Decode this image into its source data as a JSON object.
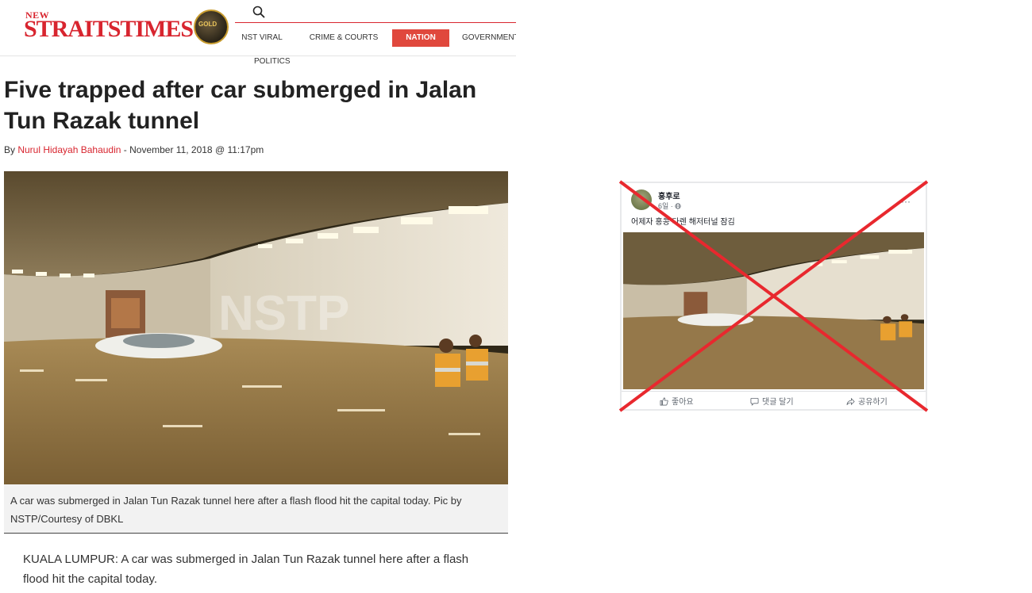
{
  "header": {
    "logo_new": "NEW",
    "logo_main": "STRAITSTIMES",
    "logo_badge": "GOLD",
    "nav": [
      {
        "label": "NST VIRAL",
        "active": false
      },
      {
        "label": "CRIME & COURTS",
        "active": false
      },
      {
        "label": "NATION",
        "active": true
      },
      {
        "label": "GOVERNMENT",
        "active": false
      }
    ],
    "nav_second_row": "POLITICS",
    "search_icon": "search-icon",
    "accent_color": "#d8252f",
    "active_tab_color": "#e0483d"
  },
  "article": {
    "headline": "Five trapped after car submerged in Jalan Tun Razak tunnel",
    "byline_prefix": "By ",
    "author": "Nurul Hidayah Bahaudin",
    "date": " - November 11, 2018 @ 11:17pm",
    "photo_watermark": "NSTP",
    "caption": "A car was submerged in Jalan Tun Razak tunnel here after a flash flood hit the capital today. Pic by NSTP/Courtesy of DBKL",
    "body": "KUALA LUMPUR: A car was submerged in Jalan Tun Razak tunnel here after a flash flood hit the capital today."
  },
  "facebook_post": {
    "user": "홍후로",
    "time": "6일 · ",
    "globe_icon": "globe-icon",
    "post_text": "어제자 홍콩 다렌 해저터널 잠김",
    "actions": [
      "좋아요",
      "댓글 달기",
      "공유하기"
    ],
    "overlay": "red-x-cross",
    "overlay_color": "#e8282e"
  }
}
